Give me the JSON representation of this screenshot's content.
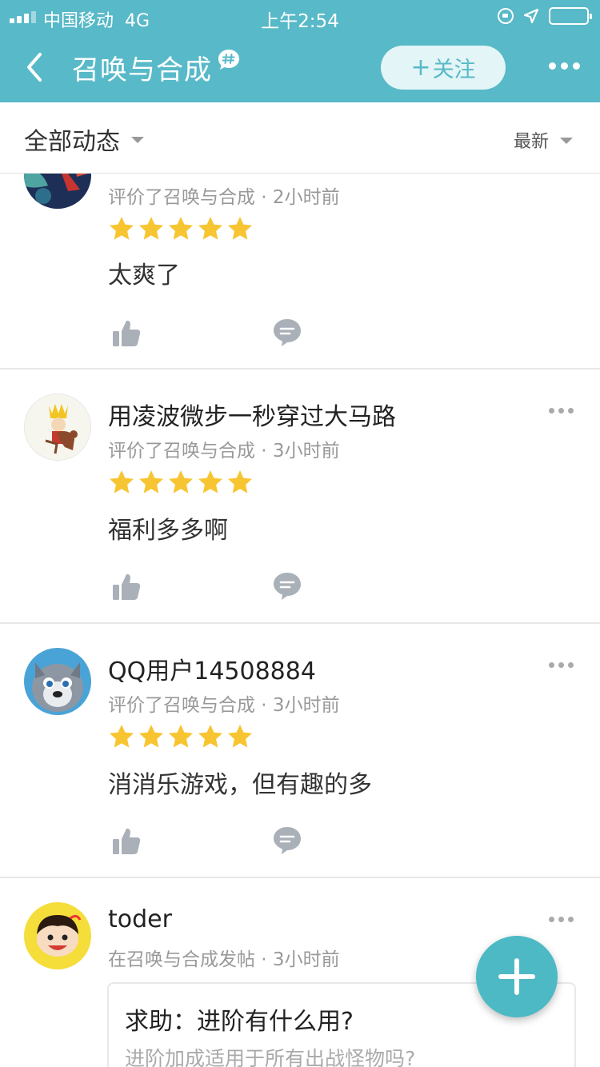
{
  "status_bar": {
    "carrier": "中国移动",
    "network": "4G",
    "time": "上午2:54"
  },
  "nav": {
    "title": "召唤与合成",
    "follow_label": "关注",
    "follow_plus": "+"
  },
  "filter": {
    "scope": "全部动态",
    "sort": "最新"
  },
  "colors": {
    "brand": "#58b9c8",
    "star": "#f7c531",
    "meta_text": "#999999"
  },
  "feed": [
    {
      "username": "",
      "meta": "评价了召唤与合成 · 2小时前",
      "rating": 5,
      "text": "太爽了"
    },
    {
      "username": "用凌波微步一秒穿过大马路",
      "meta": "评价了召唤与合成 · 3小时前",
      "rating": 5,
      "text": "福利多多啊"
    },
    {
      "username": "QQ用户14508884",
      "meta": "评价了召唤与合成 · 3小时前",
      "rating": 5,
      "text": "消消乐游戏，但有趣的多"
    },
    {
      "username": "toder",
      "meta": "在召唤与合成发帖 · 3小时前",
      "post": {
        "title": "求助：进阶有什么用?",
        "excerpt": "进阶加成适用于所有出战怪物吗?"
      }
    }
  ],
  "icons": {
    "back": "chevron-left-icon",
    "topic": "hashtag-bubble-icon",
    "more": "ellipsis-icon",
    "like": "thumbs-up-icon",
    "comment": "comment-bubble-icon",
    "fab": "plus-icon"
  }
}
